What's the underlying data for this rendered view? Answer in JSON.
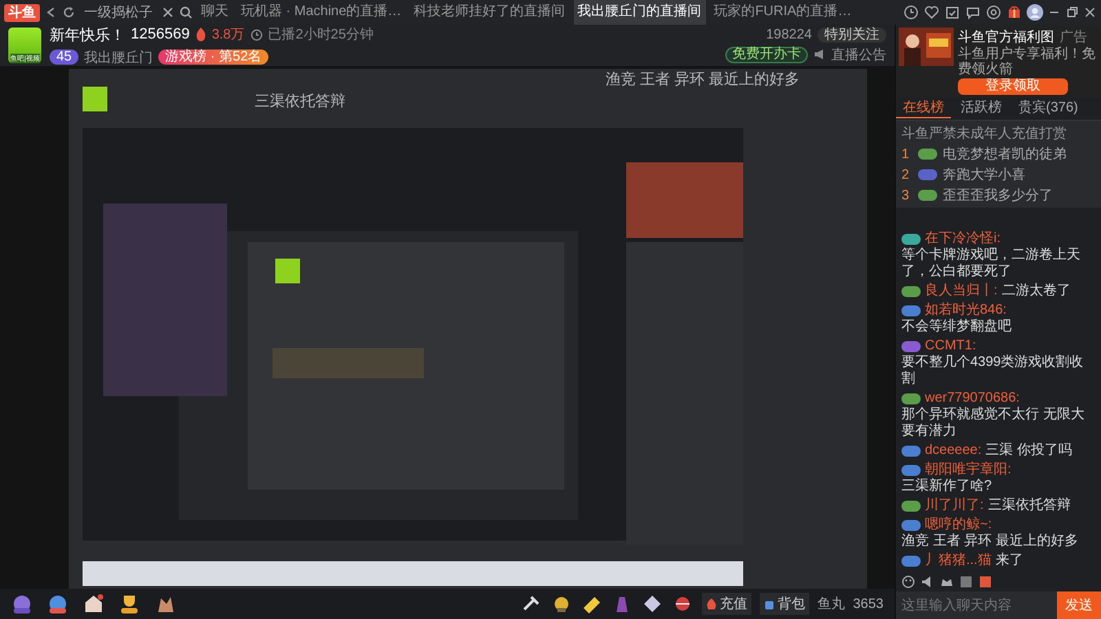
{
  "topbar": {
    "logo": "斗鱼",
    "search_text": "一级捣松子",
    "tabs": [
      {
        "label": "聊天",
        "selected": false
      },
      {
        "label": "玩机器 · Machine的直播…",
        "selected": false
      },
      {
        "label": "科技老师挂好了的直播间",
        "selected": false
      },
      {
        "label": "我出腰丘门的直播间",
        "selected": true
      },
      {
        "label": "玩家的FURIA的直播…",
        "selected": false
      }
    ]
  },
  "room": {
    "title": "新年快乐！",
    "room_id": "1256569",
    "heat": "3.8万",
    "duration": "已播2小时25分钟",
    "avatar_label": "鱼吧|视频",
    "level": "45",
    "anchor_name": "我出腰丘门",
    "rank": "游戏榜 · 第52名",
    "followers": "198224",
    "follow_button": "特别关注",
    "free_card": "免费开办卡",
    "notice": "直播公告"
  },
  "ad": {
    "title": "斗鱼官方福利图",
    "tag": "广告",
    "text": "斗鱼用户专享福利！免费领火箭",
    "button": "登录领取"
  },
  "video": {
    "kind": "picture",
    "danmaku": [
      "三渠依托答辩",
      "渔竞 王者 异环 最近上的好多"
    ]
  },
  "chat": {
    "tabs": [
      {
        "label": "在线榜",
        "selected": true
      },
      {
        "label": "活跃榜",
        "selected": false
      },
      {
        "label": "贵宾(376)",
        "selected": false
      }
    ],
    "notice": "斗鱼严禁未成年人充值打赏",
    "ranks": [
      {
        "rank": "1",
        "name": "电竞梦想者凯的徒弟",
        "color": "#5a9e4a"
      },
      {
        "rank": "2",
        "name": "奔跑大学小喜",
        "color": "#5a62c8"
      },
      {
        "rank": "3",
        "name": "歪歪歪我多少分了",
        "color": "#5a9e4a"
      }
    ],
    "messages": [
      {
        "user": "在下冷冷怪i:",
        "text": "等个卡牌游戏吧，二游卷上天了，公白都要死了",
        "color": "#3aa89a"
      },
      {
        "user": "良人当归丨:",
        "text": "二游太卷了",
        "color": "#5a9e4a"
      },
      {
        "user": "如若时光846:",
        "text": "不会等绯梦翻盘吧",
        "color": "#4a7ed0"
      },
      {
        "user": "CCMT1:",
        "text": "要不整几个4399类游戏收割收割",
        "color": "#8a5ad0"
      },
      {
        "user": "wer779070686:",
        "text": "那个异环就感觉不太行 无限大要有潜力",
        "color": "#5a9e4a"
      },
      {
        "user": "dceeeee:",
        "text": "三渠 你投了吗",
        "color": "#4a7ed0"
      },
      {
        "user": "朝阳唯宇章阳:",
        "text": "三渠新作了啥?",
        "color": "#4a7ed0"
      },
      {
        "user": "川了川了:",
        "text": "三渠依托答辩",
        "color": "#5a9e4a"
      },
      {
        "user": "嗯哼的鲸~:",
        "text": "渔竞 王者 异环 最近上的好多",
        "color": "#4a7ed0"
      },
      {
        "user": "丿猪猪...猫",
        "text": "来了",
        "color": "#4a7ed0"
      }
    ],
    "input": {
      "placeholder": "这里输入聊天内容"
    },
    "send": "发送"
  },
  "gift_bar": {
    "recharge": "充值",
    "backpack": "背包",
    "balance_label": "鱼丸",
    "balance": "3653"
  }
}
